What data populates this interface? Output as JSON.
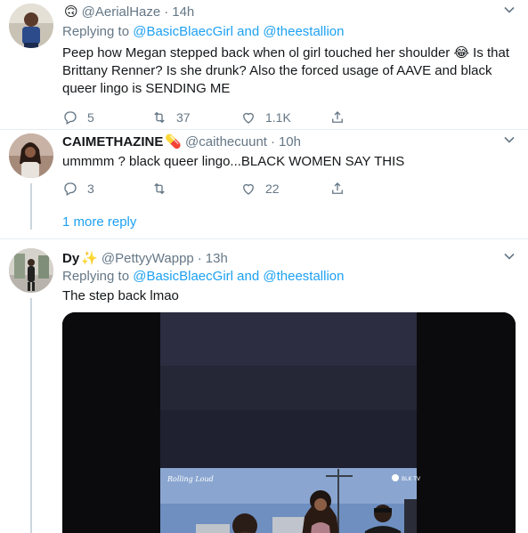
{
  "tweets": [
    {
      "name": "",
      "name_emoji": "🙃",
      "handle": "@AerialHaze",
      "time": "14h",
      "reply_prefix": "Replying to",
      "reply_mention_1": "@BasicBlaecGirl",
      "reply_and": "and",
      "reply_mention_2": "@theestallion",
      "text_line_1": "Peep how Megan stepped back when ol girl touched her shoulder 😂 Is that",
      "text_line_2": "Brittany Renner? Is she drunk? Also the forced usage of AAVE and black",
      "text_line_3": "queer lingo is SENDING ME",
      "replies": "5",
      "retweets": "37",
      "likes": "1.1K"
    },
    {
      "name": "CAIMETHAZINE",
      "name_emoji": "💊",
      "handle": "@caithecuunt",
      "time": "10h",
      "text_line_1": "ummmm ?  black queer lingo...BLACK WOMEN SAY THIS",
      "replies": "3",
      "retweets": "",
      "likes": "22"
    },
    {
      "name": "Dy",
      "name_emoji": "✨",
      "handle": "@PettyyWappp",
      "time": "13h",
      "reply_prefix": "Replying to",
      "reply_mention_1": "@BasicBlaecGirl",
      "reply_and": "and",
      "reply_mention_2": "@theestallion",
      "text_line_1": "The step back lmao"
    }
  ],
  "more_replies": "1 more reply",
  "video_watermark_left": "Rolling Loud",
  "video_watermark_right": "BLK TV",
  "colors": {
    "link": "#1da1f2",
    "muted": "#657786",
    "divider": "#e6ecf0"
  },
  "icons": [
    "reply-icon",
    "retweet-icon",
    "like-icon",
    "share-icon",
    "chevron-down-icon"
  ]
}
